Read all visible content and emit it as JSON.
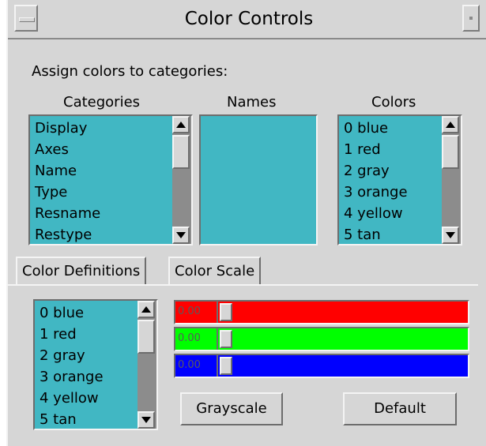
{
  "window": {
    "title": "Color Controls"
  },
  "assign_label": "Assign colors to categories:",
  "categories": {
    "header": "Categories",
    "items": [
      "Display",
      "Axes",
      "Name",
      "Type",
      "Resname",
      "Restype"
    ]
  },
  "names": {
    "header": "Names",
    "items": []
  },
  "colors": {
    "header": "Colors",
    "items": [
      "0 blue",
      "1 red",
      "2 gray",
      "3 orange",
      "4 yellow",
      "5 tan"
    ]
  },
  "tabs": [
    {
      "label": "Color Definitions",
      "selected": true
    },
    {
      "label": "Color Scale",
      "selected": false
    }
  ],
  "definitions": {
    "items": [
      "0 blue",
      "1 red",
      "2 gray",
      "3 orange",
      "4 yellow",
      "5 tan"
    ]
  },
  "sliders": [
    {
      "name": "red",
      "value": "0.00",
      "color": "#ff0000"
    },
    {
      "name": "green",
      "value": "0.00",
      "color": "#00ff00"
    },
    {
      "name": "blue",
      "value": "0.00",
      "color": "#0000ff"
    }
  ],
  "buttons": {
    "grayscale": "Grayscale",
    "default": "Default"
  },
  "theme": {
    "list_bg": "#41b7c3",
    "panel_bg": "#d6d6d6"
  }
}
